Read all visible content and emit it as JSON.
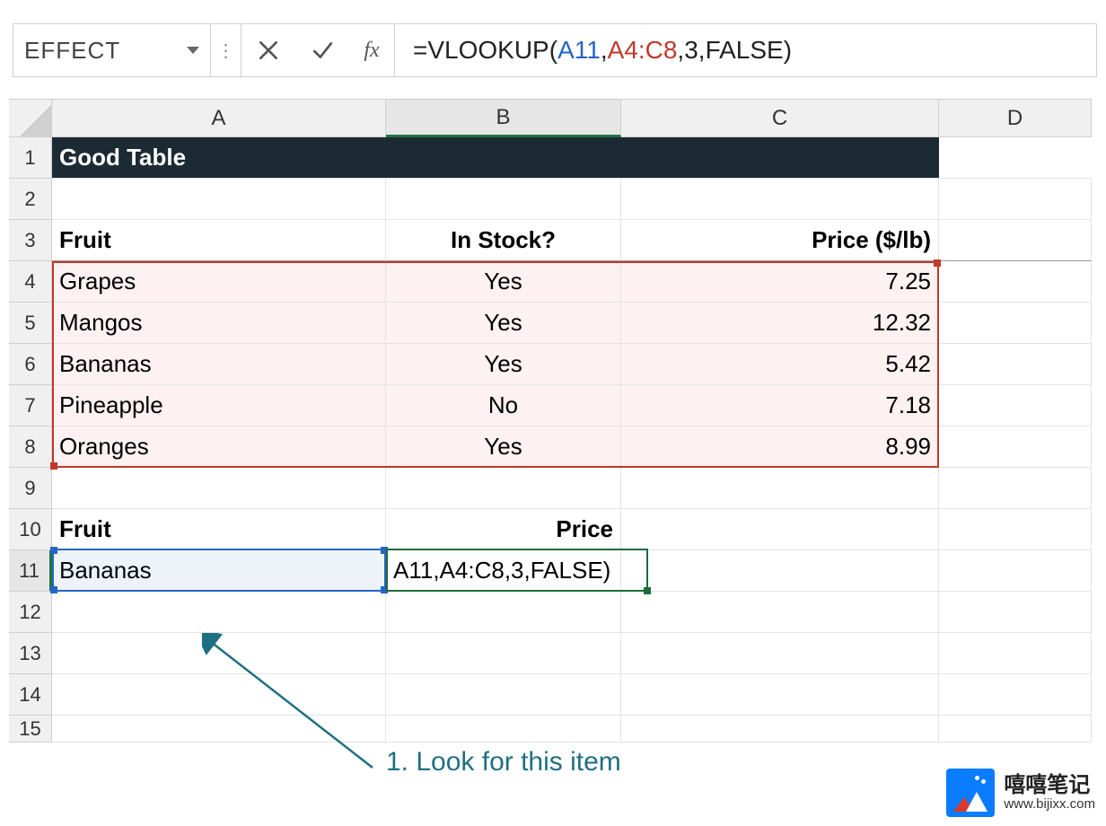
{
  "formula_bar": {
    "name_box": "EFFECT",
    "formula_raw": "=VLOOKUP(A11,A4:C8,3,FALSE)",
    "fn": "=VLOOKUP",
    "paren_open": "(",
    "arg1": "A11",
    "comma": ",",
    "arg2": "A4:C8",
    "arg3": "3",
    "arg4": "FALSE",
    "paren_close": ")",
    "fx_label": "fx"
  },
  "columns": {
    "A": "A",
    "B": "B",
    "C": "C",
    "D": "D"
  },
  "rows": [
    "1",
    "2",
    "3",
    "4",
    "5",
    "6",
    "7",
    "8",
    "9",
    "10",
    "11",
    "12",
    "13",
    "14",
    "15"
  ],
  "cells": {
    "A1": "Good Table",
    "A3": "Fruit",
    "B3": "In Stock?",
    "C3": "Price ($/lb)",
    "A4": "Grapes",
    "B4": "Yes",
    "C4": "7.25",
    "A5": "Mangos",
    "B5": "Yes",
    "C5": "12.32",
    "A6": "Bananas",
    "B6": "Yes",
    "C6": "5.42",
    "A7": "Pineapple",
    "B7": "No",
    "C7": "7.18",
    "A8": "Oranges",
    "B8": "Yes",
    "C8": "8.99",
    "A10": "Fruit",
    "B10": "Price",
    "A11": "Bananas",
    "B11": "A11,A4:C8,3,FALSE)"
  },
  "annotation": {
    "text": "1. Look for this item"
  },
  "watermark": {
    "title": "嘻嘻笔记",
    "url": "www.bijixx.com"
  }
}
